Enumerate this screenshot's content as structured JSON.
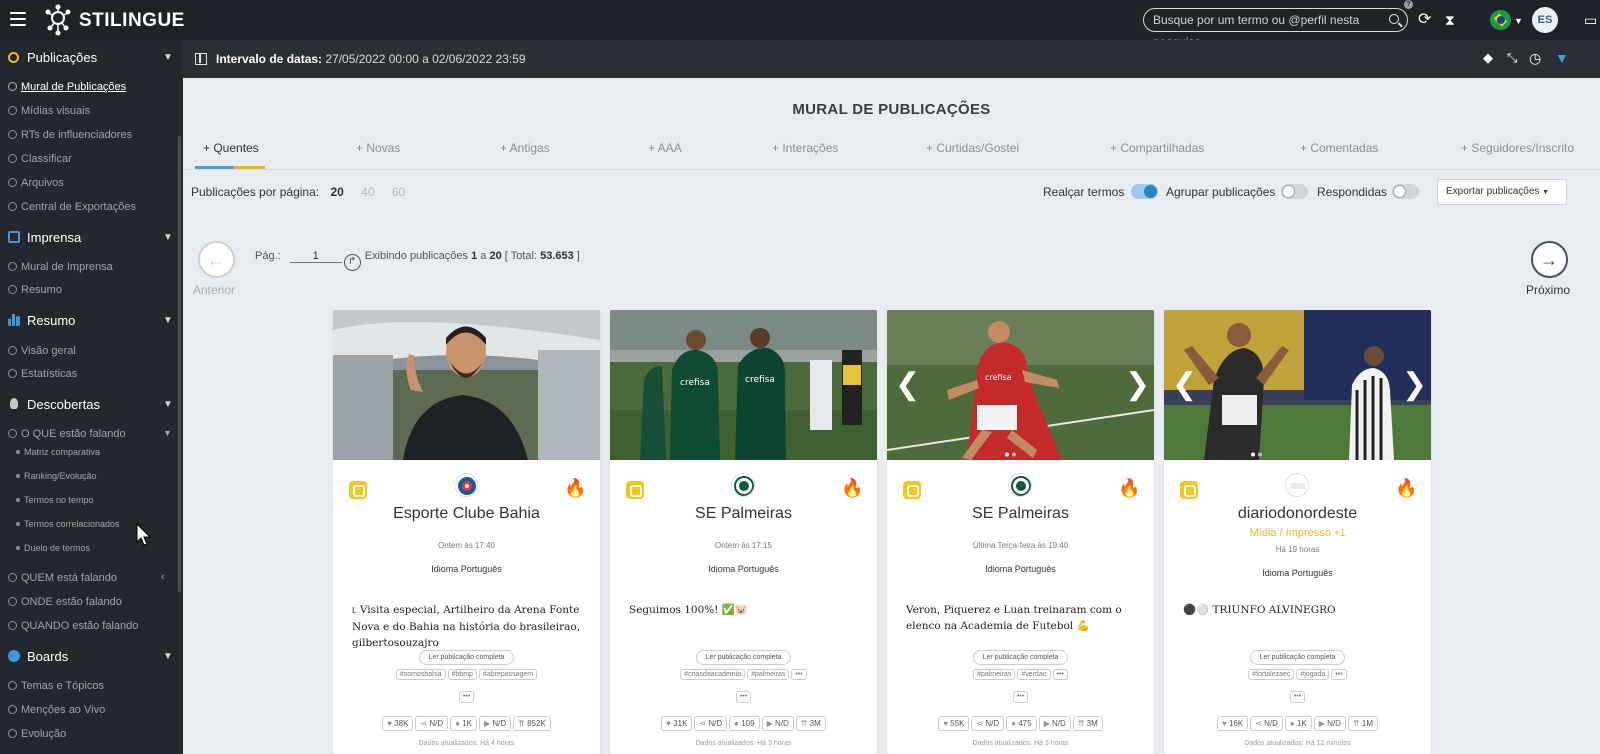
{
  "app": {
    "name": "STILINGUE",
    "search_placeholder": "Busque por um termo ou @perfil nesta pesquisa",
    "help": "?",
    "avatar": "ES"
  },
  "colors": {
    "accent": "#2a86c5",
    "insta": "#f5c518",
    "fire": "#e8731a",
    "tag": "#f0b429"
  },
  "sidebar": {
    "sections": [
      {
        "label": "Publicações",
        "icon": "eye-icon",
        "items": [
          "Mural de Publicações",
          "Mídias visuais",
          "RTs de influenciadores",
          "Classificar",
          "Arquivos",
          "Central de Exportações"
        ]
      },
      {
        "label": "Imprensa",
        "icon": "newspaper-icon",
        "items": [
          "Mural de Imprensa",
          "Resumo"
        ]
      },
      {
        "label": "Resumo",
        "icon": "bar-chart-icon",
        "items": [
          "Visão geral",
          "Estatísticas"
        ]
      },
      {
        "label": "Descobertas",
        "icon": "lightbulb-icon",
        "items": [
          "O QUE estão falando"
        ],
        "subitems": [
          "Matriz comparativa",
          "Ranking/Evolução",
          "Termos no tempo",
          "Termos correlacionados",
          "Duelo de termos"
        ],
        "items2": [
          "QUEM está falando",
          "ONDE estão falando",
          "QUANDO estão falando"
        ]
      },
      {
        "label": "Boards",
        "icon": "globe-icon",
        "items": [
          "Temas e Tópicos",
          "Menções ao Vivo",
          "Evolução"
        ]
      }
    ]
  },
  "datebar": {
    "label": "Intervalo de datas:",
    "value": " 27/05/2022 00:00 a 02/06/2022 23:59"
  },
  "main": {
    "title": "MURAL DE PUBLICAÇÕES",
    "tabs": [
      "+ Quentes",
      "+ Novas",
      "+ Antigas",
      "+ AAA",
      "+ Interações",
      "+ Curtidas/Gostei",
      "+ Compartilhadas",
      "+ Comentadas",
      "+ Seguidores/Inscrito"
    ],
    "per_page_label": "Publicações por página:",
    "per_page": [
      "20",
      "40",
      "60"
    ],
    "toggles": [
      {
        "label": "Realçar termos",
        "on": true
      },
      {
        "label": "Agrupar publicações",
        "on": false
      },
      {
        "label": "Respondidas",
        "on": false
      }
    ],
    "export": "Exportar publicações",
    "prev": "Anterior",
    "next": "Próximo",
    "page_label": "Pág.:",
    "page_value": "1",
    "showing": "Exibindo publicações",
    "from": "1",
    "a": "a",
    "to": "20",
    "total_label": "[ Total:",
    "total": "53.653",
    "total_end": "]"
  },
  "cards": [
    {
      "name": "Esporte Clube Bahia",
      "tag": "",
      "time": "Ontem às 17:40",
      "lang": "Idioma Português",
      "text": "Visita especial, Artilheiro da Arena Fonte Nova e do Bahia na história do brasileirao, gilbertosouzajro",
      "hashtags": [
        "#somosbahia",
        "#bbmp",
        "#abrepassagem"
      ],
      "likes": "38K",
      "shares": "N/D",
      "comments": "1K",
      "views": "N/D",
      "reach": "852K",
      "readmore": "Ler publicação completa",
      "more": "•••",
      "updated": "Dados atualizados: Há 4 horas"
    },
    {
      "name": "SE Palmeiras",
      "tag": "",
      "time": "Ontem às 17:15",
      "lang": "Idioma Português",
      "text": "Seguimos 100%! ✅🐷",
      "hashtags": [
        "#criasdaacademia",
        "#palmeiras"
      ],
      "likes": "31K",
      "shares": "N/D",
      "comments": "109",
      "views": "N/D",
      "reach": "3M",
      "readmore": "Ler publicação completa",
      "more": "•••",
      "updated": "Dados atualizados: Há 3 horas"
    },
    {
      "name": "SE Palmeiras",
      "tag": "",
      "time": "Última Terça-feira às 19:40",
      "lang": "Idioma Português",
      "text": "Veron, Piquerez e Luan treinaram com o elenco na Academia de Futebol 💪",
      "hashtags": [
        "#palmeiras",
        "#verdao"
      ],
      "likes": "55K",
      "shares": "N/D",
      "comments": "475",
      "views": "N/D",
      "reach": "3M",
      "readmore": "Ler publicação completa",
      "more": "•••",
      "updated": "Dados atualizados: Há 3 horas"
    },
    {
      "name": "diariodonordeste",
      "tag": "Mídia / Impresso",
      "tag_more": "+1",
      "time": "Há 19 horas",
      "lang": "Idioma Português",
      "text": "⚫⚪ TRIUNFO ALVINEGRO",
      "hashtags": [
        "#fortalezaec",
        "#jogada"
      ],
      "likes": "16K",
      "shares": "N/D",
      "comments": "1K",
      "views": "N/D",
      "reach": "1M",
      "readmore": "Ler publicação completa",
      "more": "•••",
      "updated": "Dados atualizados: Há 12 minutos"
    }
  ]
}
